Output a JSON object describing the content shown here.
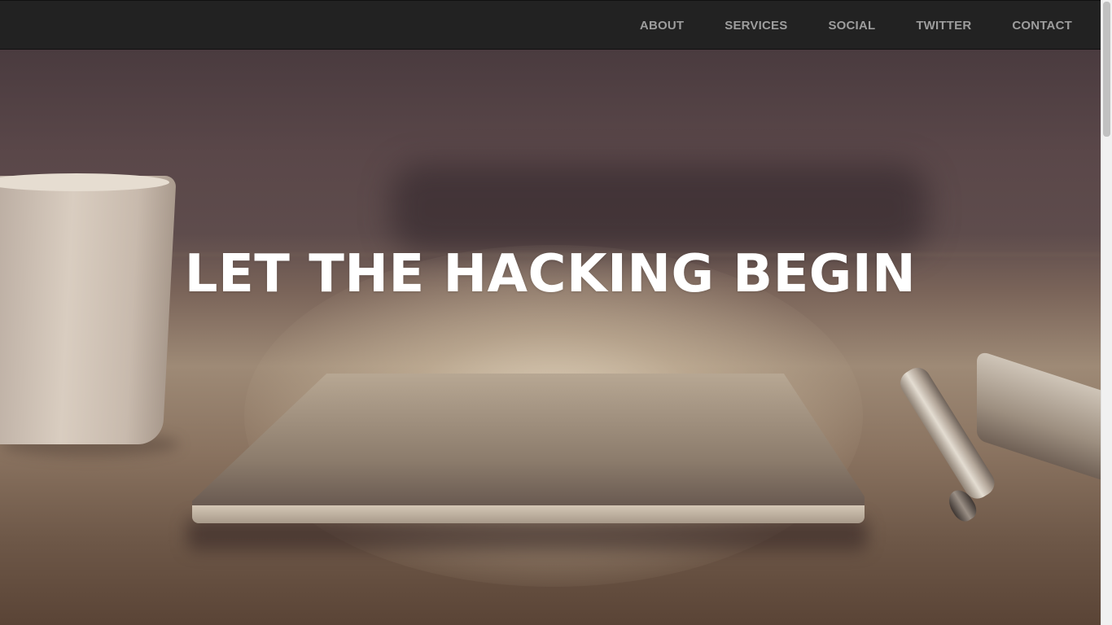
{
  "nav": {
    "items": [
      {
        "label": "ABOUT"
      },
      {
        "label": "SERVICES"
      },
      {
        "label": "SOCIAL"
      },
      {
        "label": "TWITTER"
      },
      {
        "label": "CONTACT"
      }
    ]
  },
  "hero": {
    "title": "LET THE HACKING BEGIN"
  },
  "colors": {
    "navbar_bg": "#222222",
    "nav_text": "#9d9d9d",
    "hero_title": "#ffffff"
  },
  "scroll": {
    "position_fraction": 0.0
  }
}
